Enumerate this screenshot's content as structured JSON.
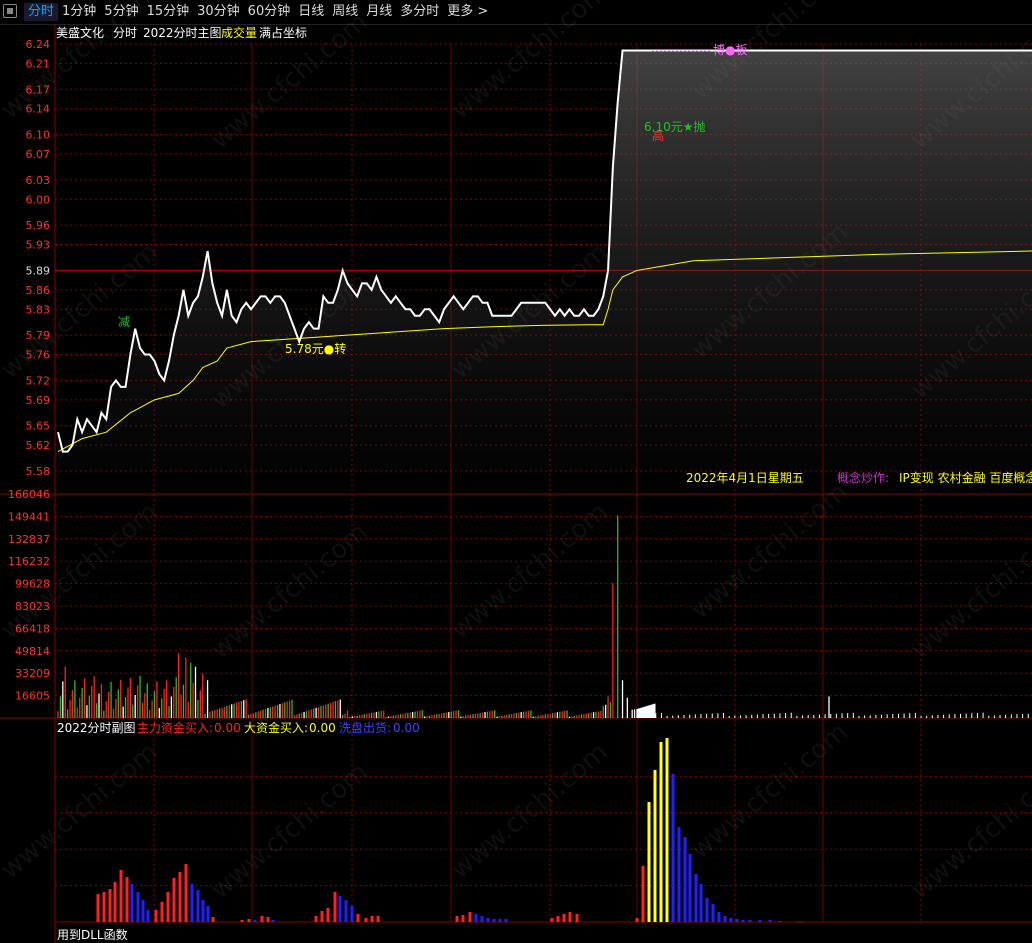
{
  "toolbar": {
    "tabs": [
      "分时",
      "1分钟",
      "5分钟",
      "15分钟",
      "30分钟",
      "60分钟",
      "日线",
      "周线",
      "月线",
      "多分时",
      "更多 >"
    ],
    "active_tab": "分时"
  },
  "header": {
    "stock_name": "美盛文化",
    "mode": "分时",
    "indicator": "2022分时主图",
    "volume_label": "成交量",
    "fullscale_label": "满占坐标"
  },
  "info": {
    "date": "2022年4月1日星期五",
    "concept_label": "概念炒作:",
    "concept_text": "IP变现 农村金融 百度概念"
  },
  "annotations": {
    "jian": "减",
    "zhuan": "5.78元●转",
    "pao": "6.10元★抛",
    "gao": "高",
    "bo": "博●板"
  },
  "sub_panel": {
    "title": "2022分时副图",
    "main_buy_label": "主力资金买入:",
    "main_buy_value": "0.00",
    "big_buy_label": "大资金买入:",
    "big_buy_value": "0.00",
    "wash_label": "洗盘出货:",
    "wash_value": "0.00",
    "footer": "用到DLL函数"
  },
  "watermark": "www.cfchi.com",
  "colors": {
    "price_line": "#ffffff",
    "avg_line": "#ffff00",
    "grid": "#8b0000",
    "axis_text": "#ff3030",
    "up_volume": "#ff2020",
    "down_volume": "#20c020",
    "flat_volume": "#ffffff",
    "main_buy": "#ff2020",
    "big_buy": "#ffff20",
    "wash": "#2020ff",
    "concept": "#cc33cc"
  },
  "chart_data": [
    {
      "type": "line",
      "name": "price",
      "y_ticks": [
        "6.24",
        "6.21",
        "6.17",
        "6.14",
        "6.10",
        "6.07",
        "6.03",
        "6.00",
        "5.96",
        "5.93",
        "5.89",
        "5.86",
        "5.83",
        "5.79",
        "5.76",
        "5.72",
        "5.69",
        "5.65",
        "5.62",
        "5.58"
      ],
      "ylim": [
        5.58,
        6.24
      ],
      "prev_close": 5.89,
      "x_count": 240,
      "price_points": [
        [
          0,
          5.64
        ],
        [
          2,
          5.61
        ],
        [
          4,
          5.61
        ],
        [
          6,
          5.62
        ],
        [
          8,
          5.66
        ],
        [
          10,
          5.64
        ],
        [
          12,
          5.66
        ],
        [
          14,
          5.65
        ],
        [
          16,
          5.64
        ],
        [
          18,
          5.67
        ],
        [
          20,
          5.66
        ],
        [
          22,
          5.71
        ],
        [
          24,
          5.72
        ],
        [
          26,
          5.71
        ],
        [
          28,
          5.71
        ],
        [
          30,
          5.76
        ],
        [
          32,
          5.8
        ],
        [
          34,
          5.77
        ],
        [
          36,
          5.76
        ],
        [
          38,
          5.76
        ],
        [
          40,
          5.75
        ],
        [
          42,
          5.73
        ],
        [
          44,
          5.72
        ],
        [
          46,
          5.75
        ],
        [
          48,
          5.79
        ],
        [
          50,
          5.82
        ],
        [
          52,
          5.86
        ],
        [
          54,
          5.82
        ],
        [
          56,
          5.84
        ],
        [
          58,
          5.85
        ],
        [
          60,
          5.88
        ],
        [
          62,
          5.92
        ],
        [
          64,
          5.87
        ],
        [
          66,
          5.84
        ],
        [
          68,
          5.82
        ],
        [
          70,
          5.86
        ],
        [
          72,
          5.82
        ],
        [
          74,
          5.81
        ],
        [
          76,
          5.83
        ],
        [
          78,
          5.84
        ],
        [
          80,
          5.83
        ],
        [
          82,
          5.84
        ],
        [
          84,
          5.85
        ],
        [
          86,
          5.85
        ],
        [
          88,
          5.84
        ],
        [
          90,
          5.85
        ],
        [
          92,
          5.85
        ],
        [
          94,
          5.84
        ],
        [
          96,
          5.82
        ],
        [
          98,
          5.8
        ],
        [
          100,
          5.78
        ],
        [
          102,
          5.8
        ],
        [
          104,
          5.81
        ],
        [
          106,
          5.8
        ],
        [
          108,
          5.8
        ],
        [
          110,
          5.85
        ],
        [
          112,
          5.84
        ],
        [
          114,
          5.84
        ],
        [
          116,
          5.86
        ],
        [
          118,
          5.89
        ],
        [
          120,
          5.87
        ],
        [
          122,
          5.86
        ],
        [
          124,
          5.85
        ],
        [
          126,
          5.87
        ],
        [
          128,
          5.87
        ],
        [
          130,
          5.86
        ],
        [
          132,
          5.88
        ],
        [
          134,
          5.86
        ],
        [
          136,
          5.85
        ],
        [
          138,
          5.84
        ],
        [
          140,
          5.85
        ],
        [
          142,
          5.84
        ],
        [
          144,
          5.83
        ],
        [
          146,
          5.83
        ],
        [
          148,
          5.82
        ],
        [
          150,
          5.82
        ],
        [
          152,
          5.83
        ],
        [
          154,
          5.83
        ],
        [
          156,
          5.82
        ],
        [
          158,
          5.81
        ],
        [
          160,
          5.83
        ],
        [
          162,
          5.84
        ],
        [
          164,
          5.85
        ],
        [
          166,
          5.84
        ],
        [
          168,
          5.83
        ],
        [
          170,
          5.84
        ],
        [
          172,
          5.85
        ],
        [
          174,
          5.85
        ],
        [
          176,
          5.84
        ],
        [
          178,
          5.84
        ],
        [
          180,
          5.82
        ],
        [
          182,
          5.82
        ],
        [
          184,
          5.82
        ],
        [
          186,
          5.82
        ],
        [
          188,
          5.82
        ],
        [
          190,
          5.83
        ],
        [
          192,
          5.84
        ],
        [
          194,
          5.84
        ],
        [
          196,
          5.84
        ],
        [
          198,
          5.84
        ],
        [
          200,
          5.84
        ],
        [
          202,
          5.84
        ],
        [
          204,
          5.83
        ],
        [
          206,
          5.82
        ],
        [
          208,
          5.83
        ],
        [
          210,
          5.82
        ],
        [
          212,
          5.83
        ],
        [
          214,
          5.82
        ],
        [
          216,
          5.82
        ],
        [
          218,
          5.83
        ],
        [
          220,
          5.82
        ],
        [
          222,
          5.82
        ],
        [
          224,
          5.83
        ],
        [
          226,
          5.85
        ],
        [
          228,
          5.89
        ],
        [
          230,
          6.05
        ],
        [
          232,
          6.15
        ],
        [
          234,
          6.23
        ],
        [
          236,
          6.23
        ],
        [
          240,
          6.23
        ],
        [
          300,
          6.23
        ],
        [
          480,
          6.23
        ],
        [
          660,
          6.23
        ]
      ],
      "avg_points": [
        [
          0,
          5.61
        ],
        [
          10,
          5.63
        ],
        [
          20,
          5.64
        ],
        [
          30,
          5.67
        ],
        [
          40,
          5.69
        ],
        [
          50,
          5.7
        ],
        [
          56,
          5.72
        ],
        [
          60,
          5.74
        ],
        [
          66,
          5.75
        ],
        [
          70,
          5.77
        ],
        [
          80,
          5.78
        ],
        [
          100,
          5.785
        ],
        [
          120,
          5.79
        ],
        [
          140,
          5.795
        ],
        [
          160,
          5.8
        ],
        [
          180,
          5.803
        ],
        [
          200,
          5.805
        ],
        [
          220,
          5.806
        ],
        [
          226,
          5.806
        ],
        [
          228,
          5.83
        ],
        [
          230,
          5.86
        ],
        [
          234,
          5.88
        ],
        [
          240,
          5.89
        ],
        [
          260,
          5.895
        ],
        [
          300,
          5.905
        ],
        [
          400,
          5.91
        ],
        [
          500,
          5.915
        ],
        [
          660,
          5.92
        ]
      ]
    },
    {
      "type": "bar",
      "name": "volume",
      "y_ticks": [
        "166046",
        "149441",
        "132837",
        "116232",
        "99628",
        "83023",
        "66418",
        "49814",
        "33209",
        "16605"
      ],
      "ylim": [
        0,
        166046
      ]
    },
    {
      "type": "bar",
      "name": "fund_flow",
      "series": [
        {
          "name": "主力资金买入",
          "color": "#ff2020"
        },
        {
          "name": "大资金买入",
          "color": "#ffff20"
        },
        {
          "name": "洗盘出货",
          "color": "#2020ff"
        }
      ]
    }
  ]
}
